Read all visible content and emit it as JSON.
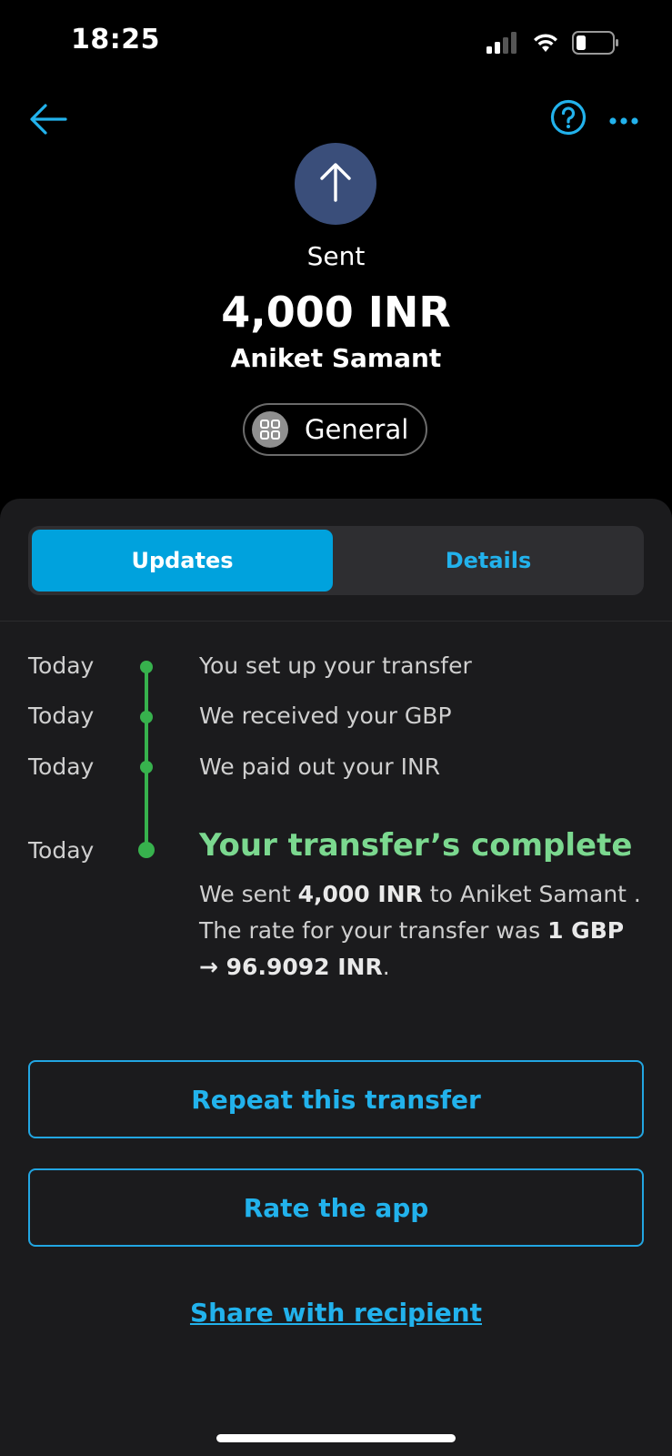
{
  "status_bar": {
    "time": "18:25",
    "icons": [
      "signal-icon",
      "wifi-icon",
      "battery-icon"
    ]
  },
  "nav": {
    "back_icon": "arrow-left-icon",
    "help_icon": "question-circle-icon",
    "more_icon": "more-horizontal-icon"
  },
  "header": {
    "status_icon": "arrow-up-icon",
    "status_label": "Sent",
    "amount": "4,000 INR",
    "recipient": "Aniket Samant",
    "category": {
      "icon": "grid-icon",
      "label": "General"
    }
  },
  "tabs": {
    "updates": "Updates",
    "details": "Details",
    "active": "updates"
  },
  "timeline": [
    {
      "date": "Today",
      "text": "You set up your transfer"
    },
    {
      "date": "Today",
      "text": "We received your GBP"
    },
    {
      "date": "Today",
      "text": "We paid out your INR"
    }
  ],
  "complete": {
    "date": "Today",
    "title": "Your transfer’s complete",
    "line1_prefix": "We sent ",
    "line1_amount": "4,000 INR",
    "line1_suffix": " to Aniket Samant .",
    "line2_prefix": "The rate for your transfer was ",
    "rate": "1 GBP → 96.9092 INR",
    "line2_suffix": "."
  },
  "actions": {
    "repeat": "Repeat this transfer",
    "rate_app": "Rate the app",
    "share": "Share with recipient"
  },
  "colors": {
    "accent": "#00a2dd",
    "link": "#22b2ec",
    "success": "#37b24d",
    "success_text": "#7bd88f",
    "avatar_bg": "#3a4e7a",
    "panel_bg": "#1b1b1d"
  }
}
